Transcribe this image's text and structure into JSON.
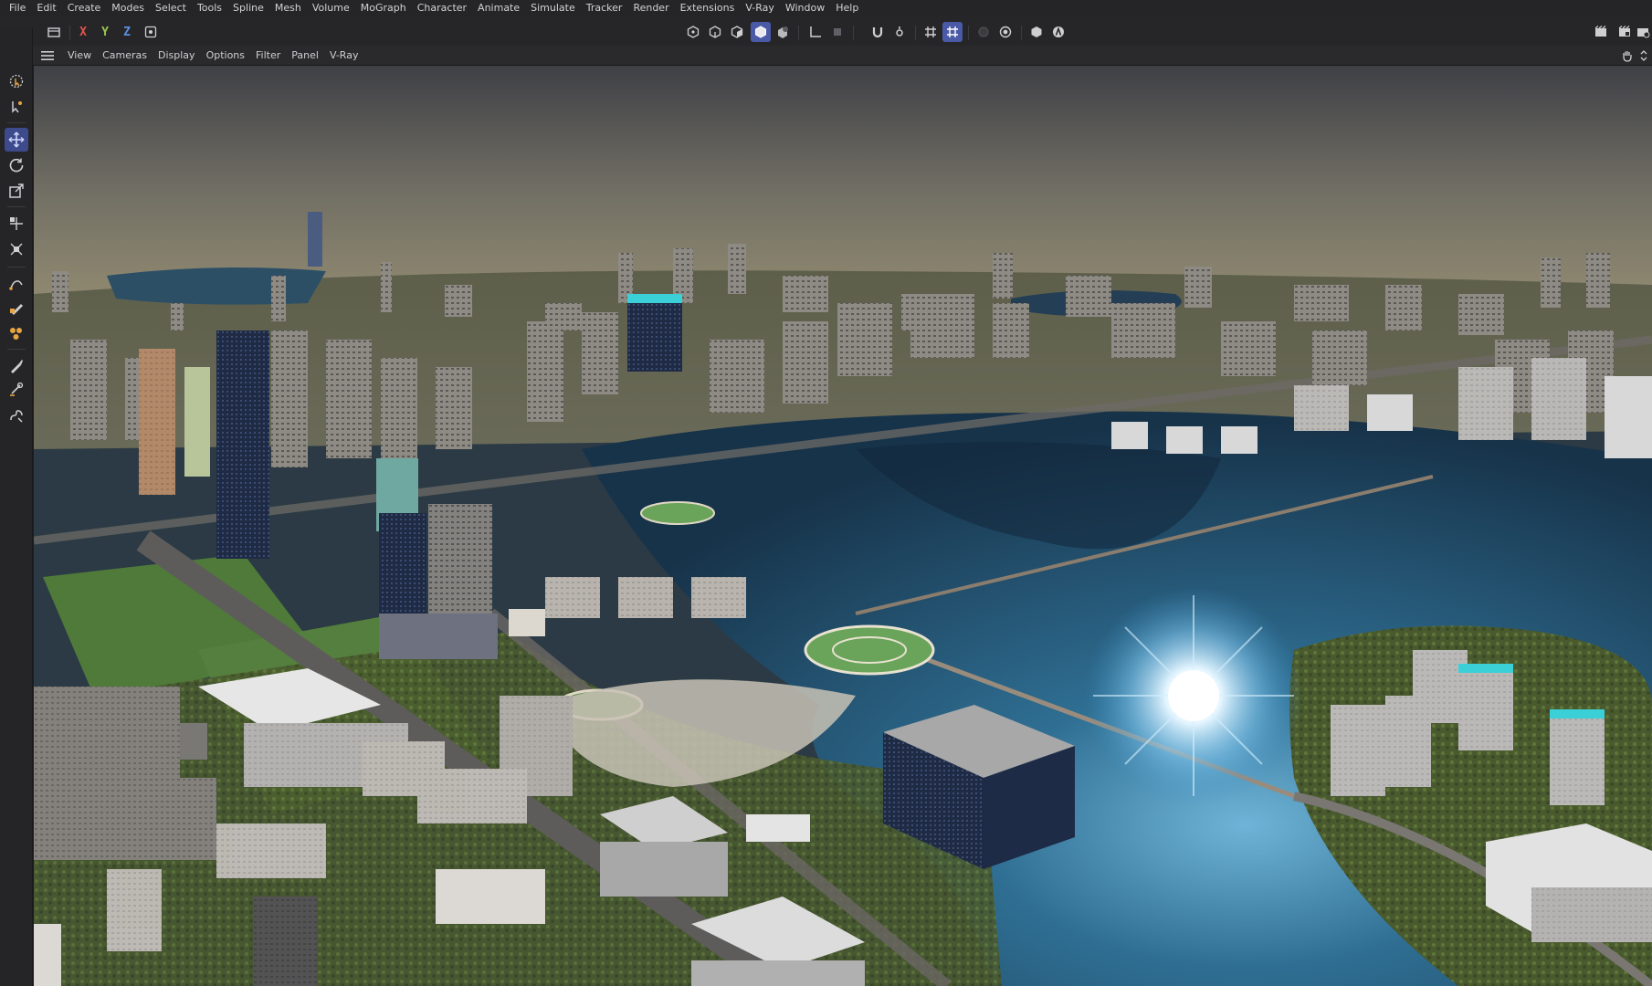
{
  "menu": [
    "File",
    "Edit",
    "Create",
    "Modes",
    "Select",
    "Tools",
    "Spline",
    "Mesh",
    "Volume",
    "MoGraph",
    "Character",
    "Animate",
    "Simulate",
    "Tracker",
    "Render",
    "Extensions",
    "V-Ray",
    "Window",
    "Help"
  ],
  "axes": {
    "x": "X",
    "y": "Y",
    "z": "Z"
  },
  "viewport_menu": [
    "View",
    "Cameras",
    "Display",
    "Options",
    "Filter",
    "Panel",
    "V-Ray"
  ],
  "colors": {
    "accent": "#4a5aa6",
    "axis_x": "#e0544e",
    "axis_y": "#9cc654",
    "axis_z": "#5a8fe0"
  },
  "icons": {
    "left_tools": [
      "search-icon",
      "live-selection-icon",
      "tweak-icon",
      "move-icon",
      "rotate-icon",
      "scale-icon",
      "transfer-icon",
      "snap-scale-icon",
      "pen-icon",
      "sketch-icon",
      "knife-icon",
      "brush-icon",
      "magnet-icon",
      "spline-icon"
    ]
  }
}
